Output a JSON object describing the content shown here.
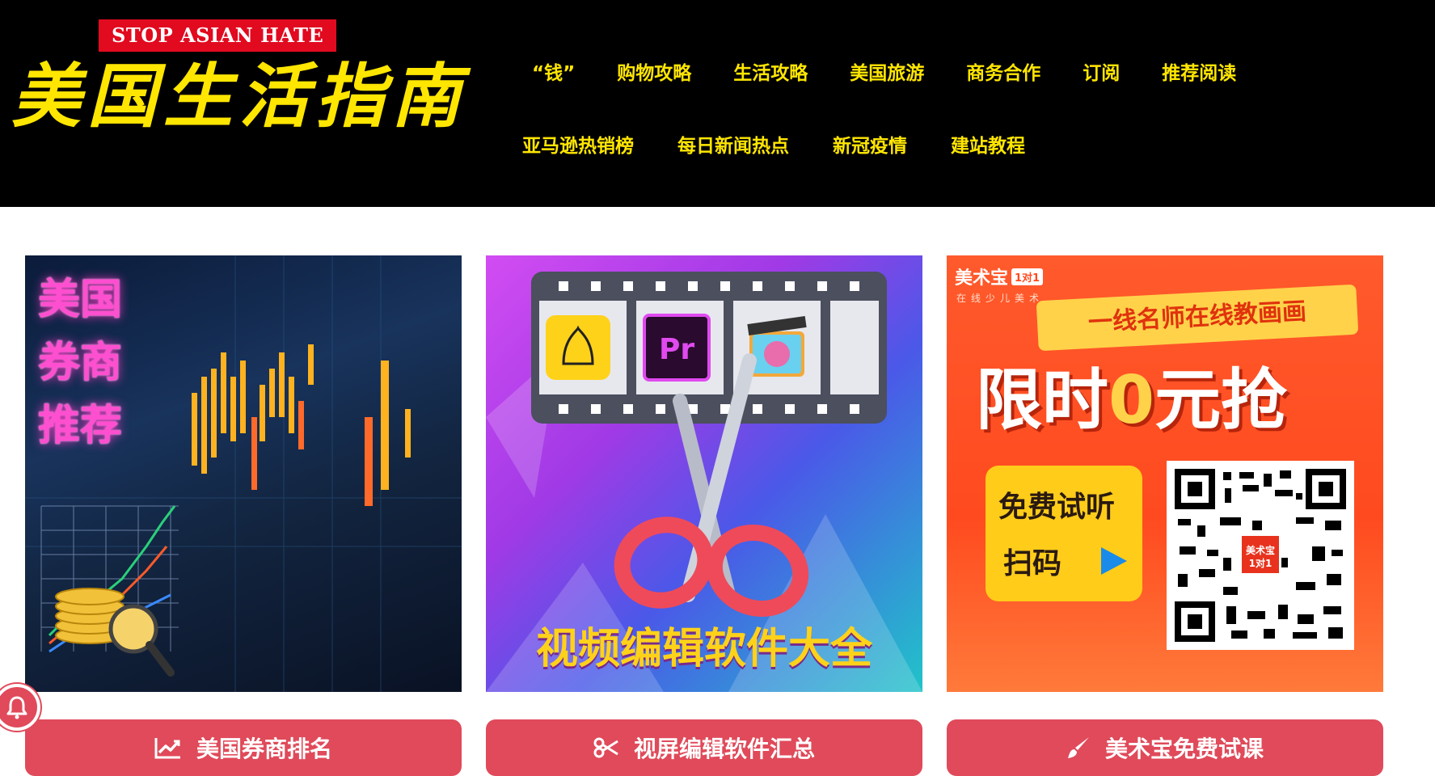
{
  "header": {
    "badge": "STOP ASIAN HATE",
    "logo_text": "美国生活指南",
    "nav_row1": [
      "“钱”",
      "购物攻略",
      "生活攻略",
      "美国旅游",
      "商务合作",
      "订阅",
      "推荐阅读"
    ],
    "nav_row2": [
      "亚马逊热销榜",
      "每日新闻热点",
      "新冠疫情",
      "建站教程"
    ]
  },
  "cards": [
    {
      "image_text": [
        "美国",
        "券商",
        "推荐"
      ],
      "icon": "chart-line-icon",
      "button_label": "美国券商排名"
    },
    {
      "image_text": "视频编辑软件大全",
      "icon": "scissors-icon",
      "button_label": "视屏编辑软件汇总"
    },
    {
      "brand": "美术宝",
      "brand_tag": "1对1",
      "brand_sub": "在线少儿美术",
      "ribbon": "一线名师在线教画画",
      "headline_a": "限时",
      "headline_zero": "0",
      "headline_b": "元抢",
      "panel_line1": "免费试听",
      "panel_line2": "扫码",
      "qr_logo": "美术宝",
      "qr_logo_tag": "1对1",
      "icon": "paint-brush-icon",
      "button_label": "美术宝免费试课"
    }
  ],
  "colors": {
    "header_bg": "#000000",
    "nav_text": "#ffe600",
    "badge_bg": "#e10a1f",
    "button_bg": "#e04a5a"
  },
  "floating": {
    "icon": "bell-icon"
  }
}
